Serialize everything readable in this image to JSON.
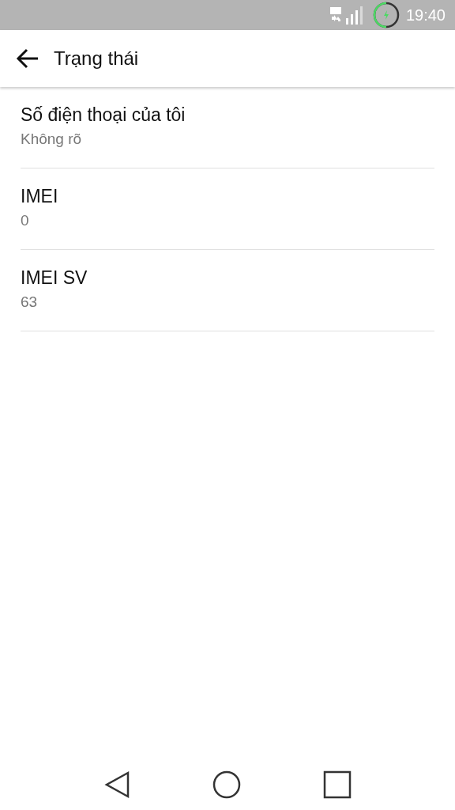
{
  "status_bar": {
    "time": "19:40"
  },
  "app_bar": {
    "title": "Trạng thái"
  },
  "items": [
    {
      "title": "Số điện thoại của tôi",
      "value": "Không rõ"
    },
    {
      "title": "IMEI",
      "value": "0"
    },
    {
      "title": "IMEI SV",
      "value": "63"
    }
  ]
}
